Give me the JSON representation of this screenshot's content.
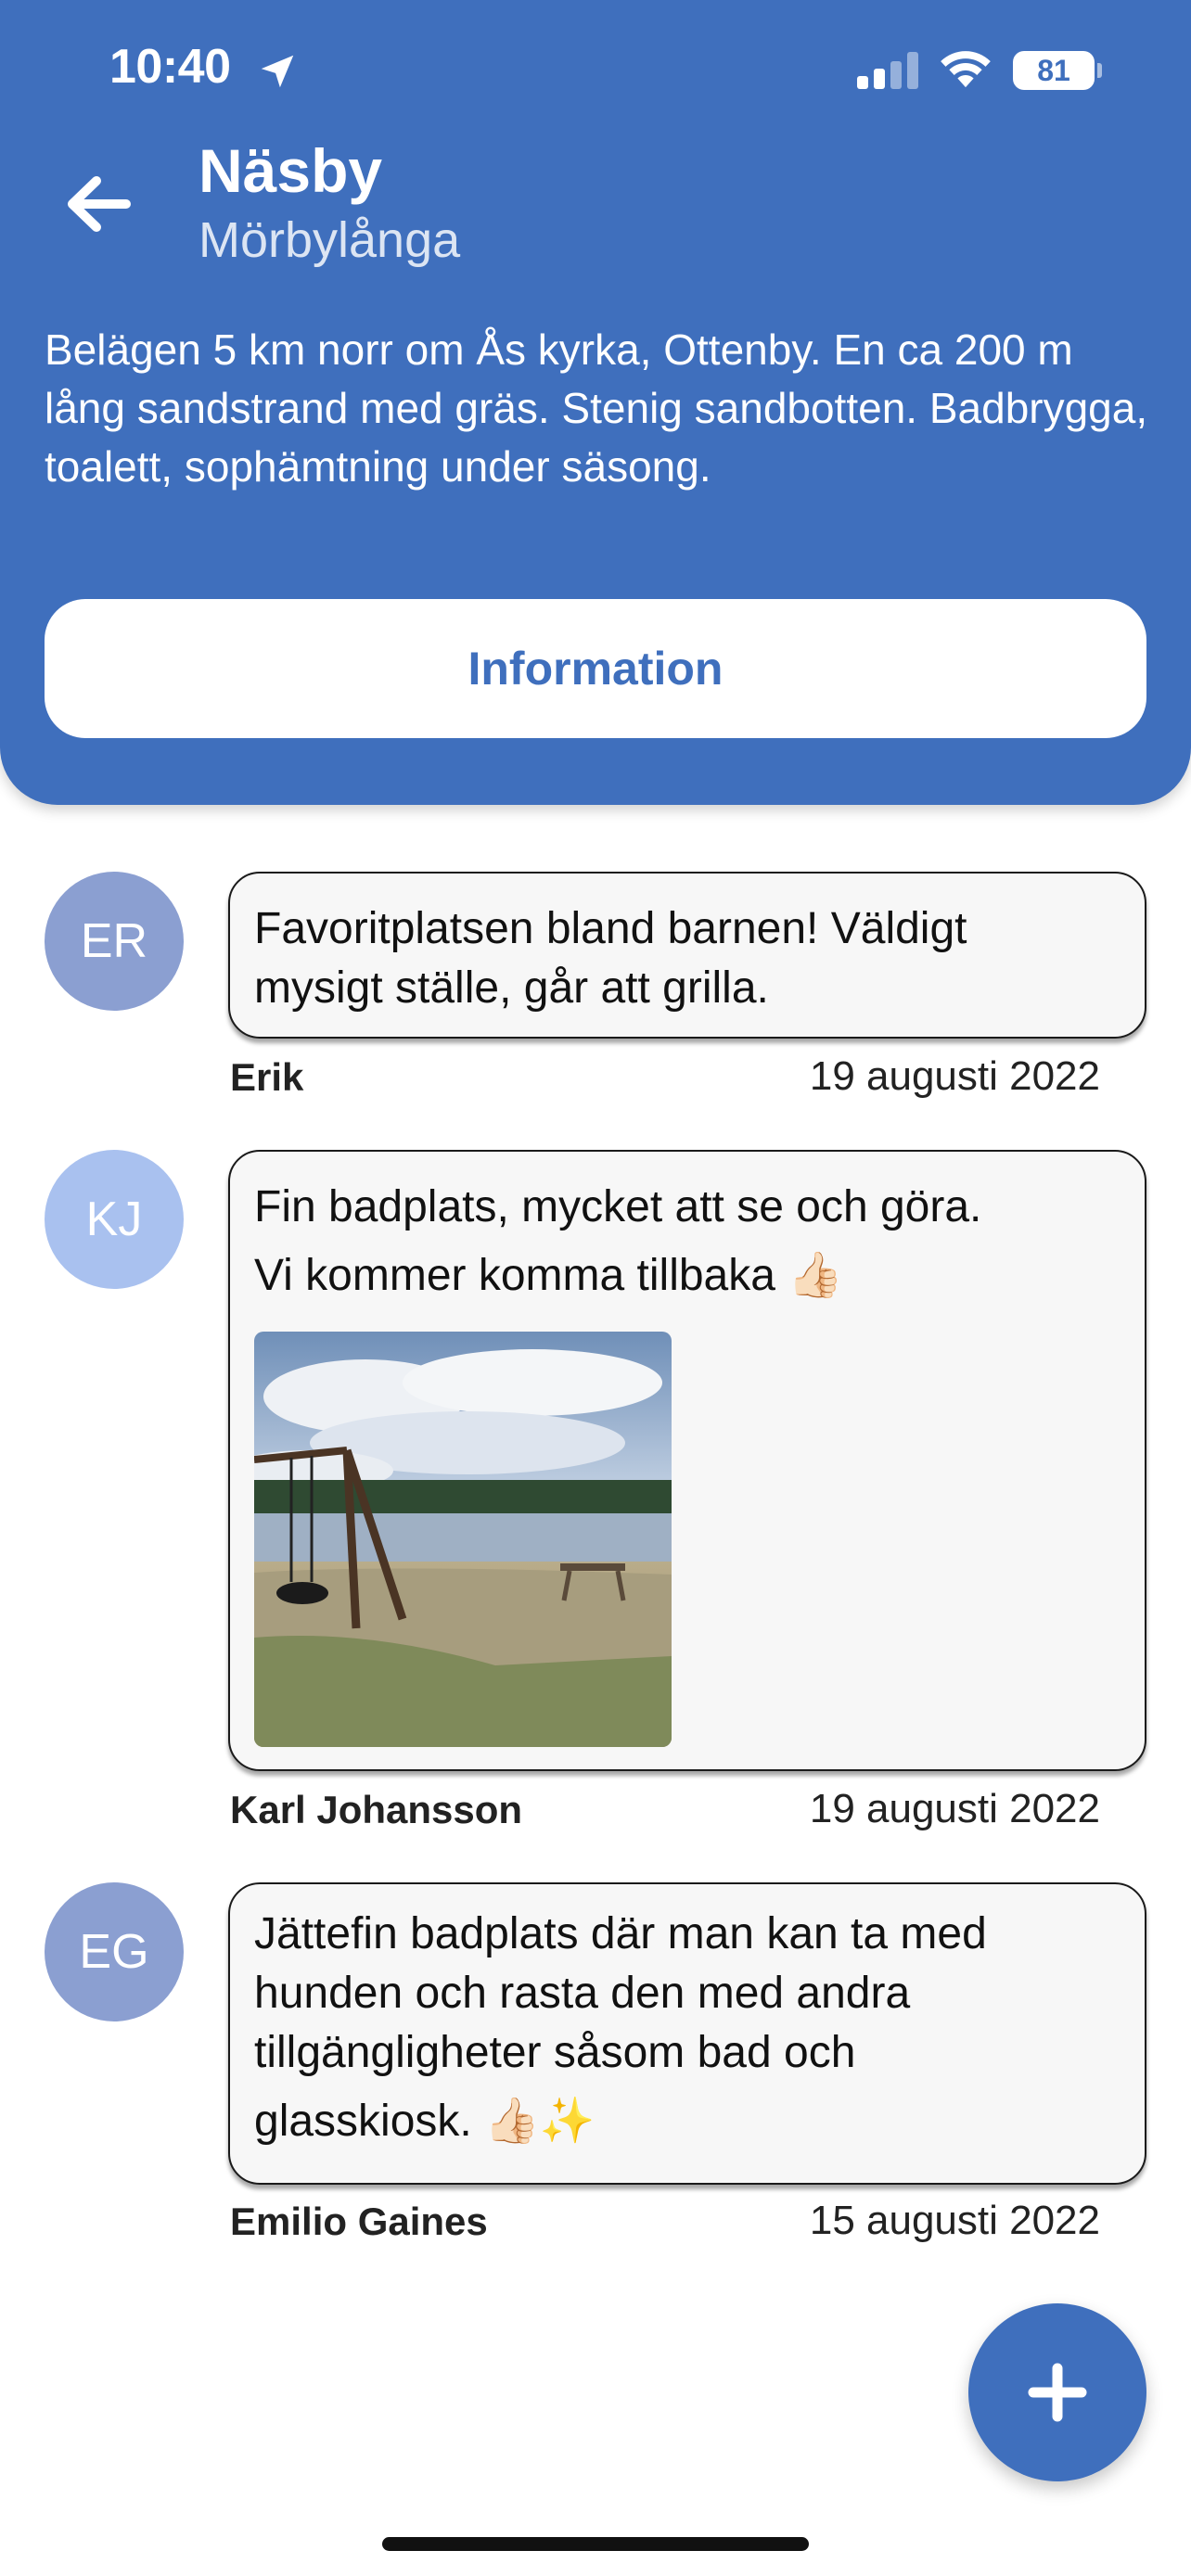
{
  "status_bar": {
    "time": "10:40",
    "battery": "81"
  },
  "header": {
    "title": "Näsby",
    "subtitle": "Mörbylånga",
    "description": "Belägen 5 km norr om Ås kyrka, Ottenby. En ca 200 m lång sandstrand med gräs. Stenig sandbotten. Badbrygga, toalett, sophämtning under säsong.",
    "info_button_label": "Information"
  },
  "comments": [
    {
      "initials": "ER",
      "avatar_color": "#8b9fd1",
      "lines": [
        "Favoritplatsen bland barnen! Väldigt",
        "mysigt ställe, går att grilla."
      ],
      "author": "Erik",
      "date": "19 augusti 2022"
    },
    {
      "initials": "KJ",
      "avatar_color": "#a9c1ef",
      "lines": [
        "Fin badplats, mycket att se och göra.",
        "Vi kommer komma tillbaka 👍🏻"
      ],
      "has_photo": true,
      "author": "Karl Johansson",
      "date": "19 augusti 2022"
    },
    {
      "initials": "EG",
      "avatar_color": "#8b9fd1",
      "lines": [
        "Jättefin badplats där man kan ta med",
        "hunden och rasta den med andra",
        "tillgängligheter såsom bad och",
        "glasskiosk. 👍🏻✨"
      ],
      "author": "Emilio Gaines",
      "date": "15 augusti 2022"
    }
  ],
  "icons": {
    "back": "arrow-left-icon",
    "location": "location-arrow-icon",
    "signal": "cellular-signal-icon",
    "wifi": "wifi-icon",
    "battery": "battery-icon",
    "fab": "plus-icon"
  },
  "colors": {
    "accent": "#3f6fbd"
  }
}
